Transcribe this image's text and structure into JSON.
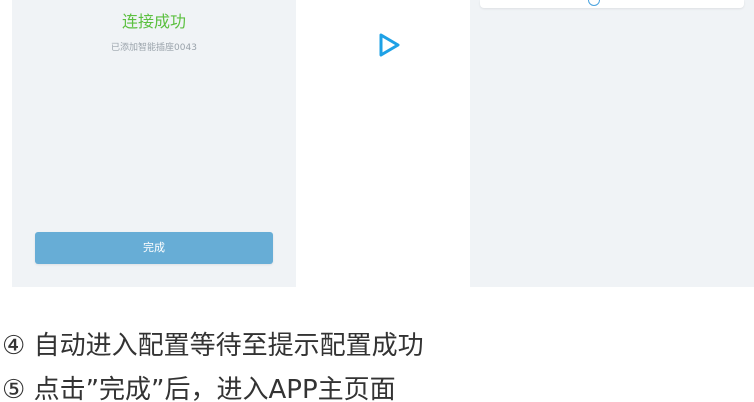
{
  "left_screen": {
    "status_title": "连接成功",
    "status_subtitle": "已添加智能插座0043",
    "done_button_label": "完成"
  },
  "arrow": {
    "icon": "play-arrow-icon",
    "color": "#1ea1e6"
  },
  "right_screen": {
    "card_icon": "info-circle-icon"
  },
  "instructions": {
    "step4": "④ 自动进入配置等待至提示配置成功",
    "step5": "⑤ 点击”完成”后，进入APP主页面"
  },
  "colors": {
    "success_green": "#5cc040",
    "button_blue": "#67add6",
    "screen_bg": "#f0f3f6"
  }
}
